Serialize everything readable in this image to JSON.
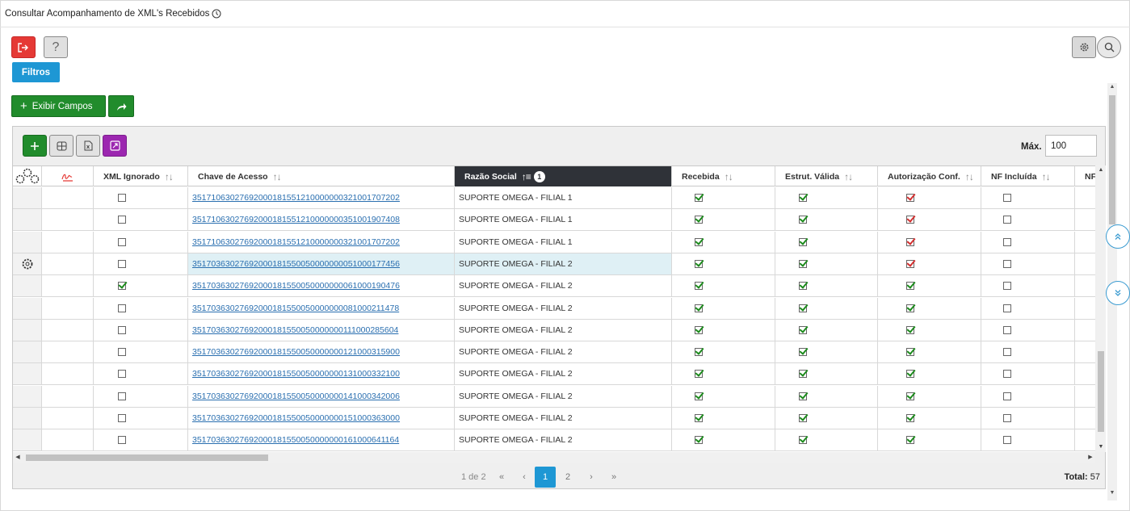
{
  "page": {
    "title": "Consultar Acompanhamento de XML's Recebidos",
    "filtros_label": "Filtros",
    "exibir_campos_label": "Exibir Campos",
    "max_label": "Máx.",
    "max_value": "100"
  },
  "columns": {
    "xml_ignorado": "XML Ignorado",
    "chave": "Chave de Acesso",
    "razao": "Razão Social",
    "razao_badge": "1",
    "recebida": "Recebida",
    "estrut": "Estrut. Válida",
    "autorizacao": "Autorização Conf.",
    "nf_incluida": "NF Incluída",
    "nf_partial": "NF"
  },
  "rows": [
    {
      "chave": "35171063027692000181551210000000321001707202",
      "razao": "SUPORTE OMEGA - FILIAL 1",
      "xml_ignorado": false,
      "recebida": true,
      "estrut": true,
      "autorizacao": "warn",
      "nf": false
    },
    {
      "chave": "35171063027692000181551210000000351001907408",
      "razao": "SUPORTE OMEGA - FILIAL 1",
      "xml_ignorado": false,
      "recebida": true,
      "estrut": true,
      "autorizacao": "warn",
      "nf": false
    },
    {
      "chave": "35171063027692000181551210000000321001707202",
      "razao": "SUPORTE OMEGA - FILIAL 1",
      "xml_ignorado": false,
      "recebida": true,
      "estrut": true,
      "autorizacao": "warn",
      "nf": false
    },
    {
      "chave": "35170363027692000181550050000000051000177456",
      "razao": "SUPORTE OMEGA - FILIAL 2",
      "xml_ignorado": false,
      "recebida": true,
      "estrut": true,
      "autorizacao": "warn",
      "nf": false
    },
    {
      "chave": "35170363027692000181550050000000061000190476",
      "razao": "SUPORTE OMEGA - FILIAL 2",
      "xml_ignorado": true,
      "recebida": true,
      "estrut": true,
      "autorizacao": "ok",
      "nf": false
    },
    {
      "chave": "35170363027692000181550050000000081000211478",
      "razao": "SUPORTE OMEGA - FILIAL 2",
      "xml_ignorado": false,
      "recebida": true,
      "estrut": true,
      "autorizacao": "ok",
      "nf": false
    },
    {
      "chave": "35170363027692000181550050000000111000285604",
      "razao": "SUPORTE OMEGA - FILIAL 2",
      "xml_ignorado": false,
      "recebida": true,
      "estrut": true,
      "autorizacao": "ok",
      "nf": false
    },
    {
      "chave": "35170363027692000181550050000000121000315900",
      "razao": "SUPORTE OMEGA - FILIAL 2",
      "xml_ignorado": false,
      "recebida": true,
      "estrut": true,
      "autorizacao": "ok",
      "nf": false
    },
    {
      "chave": "35170363027692000181550050000000131000332100",
      "razao": "SUPORTE OMEGA - FILIAL 2",
      "xml_ignorado": false,
      "recebida": true,
      "estrut": true,
      "autorizacao": "ok",
      "nf": false
    },
    {
      "chave": "35170363027692000181550050000000141000342006",
      "razao": "SUPORTE OMEGA - FILIAL 2",
      "xml_ignorado": false,
      "recebida": true,
      "estrut": true,
      "autorizacao": "ok",
      "nf": false
    },
    {
      "chave": "35170363027692000181550050000000151000363000",
      "razao": "SUPORTE OMEGA - FILIAL 2",
      "xml_ignorado": false,
      "recebida": true,
      "estrut": true,
      "autorizacao": "ok",
      "nf": false
    },
    {
      "chave": "35170363027692000181550050000000161000641164",
      "razao": "SUPORTE OMEGA - FILIAL 2",
      "xml_ignorado": false,
      "recebida": true,
      "estrut": true,
      "autorizacao": "ok",
      "nf": false
    }
  ],
  "pager": {
    "info": "1 de 2",
    "pages": [
      "1",
      "2"
    ],
    "total_label": "Total:",
    "total_value": "57"
  },
  "colors": {
    "accent": "#1e97d4",
    "green": "#218c2c",
    "red": "#e53935",
    "purple": "#9c27b0",
    "header_active": "#2f3238"
  }
}
